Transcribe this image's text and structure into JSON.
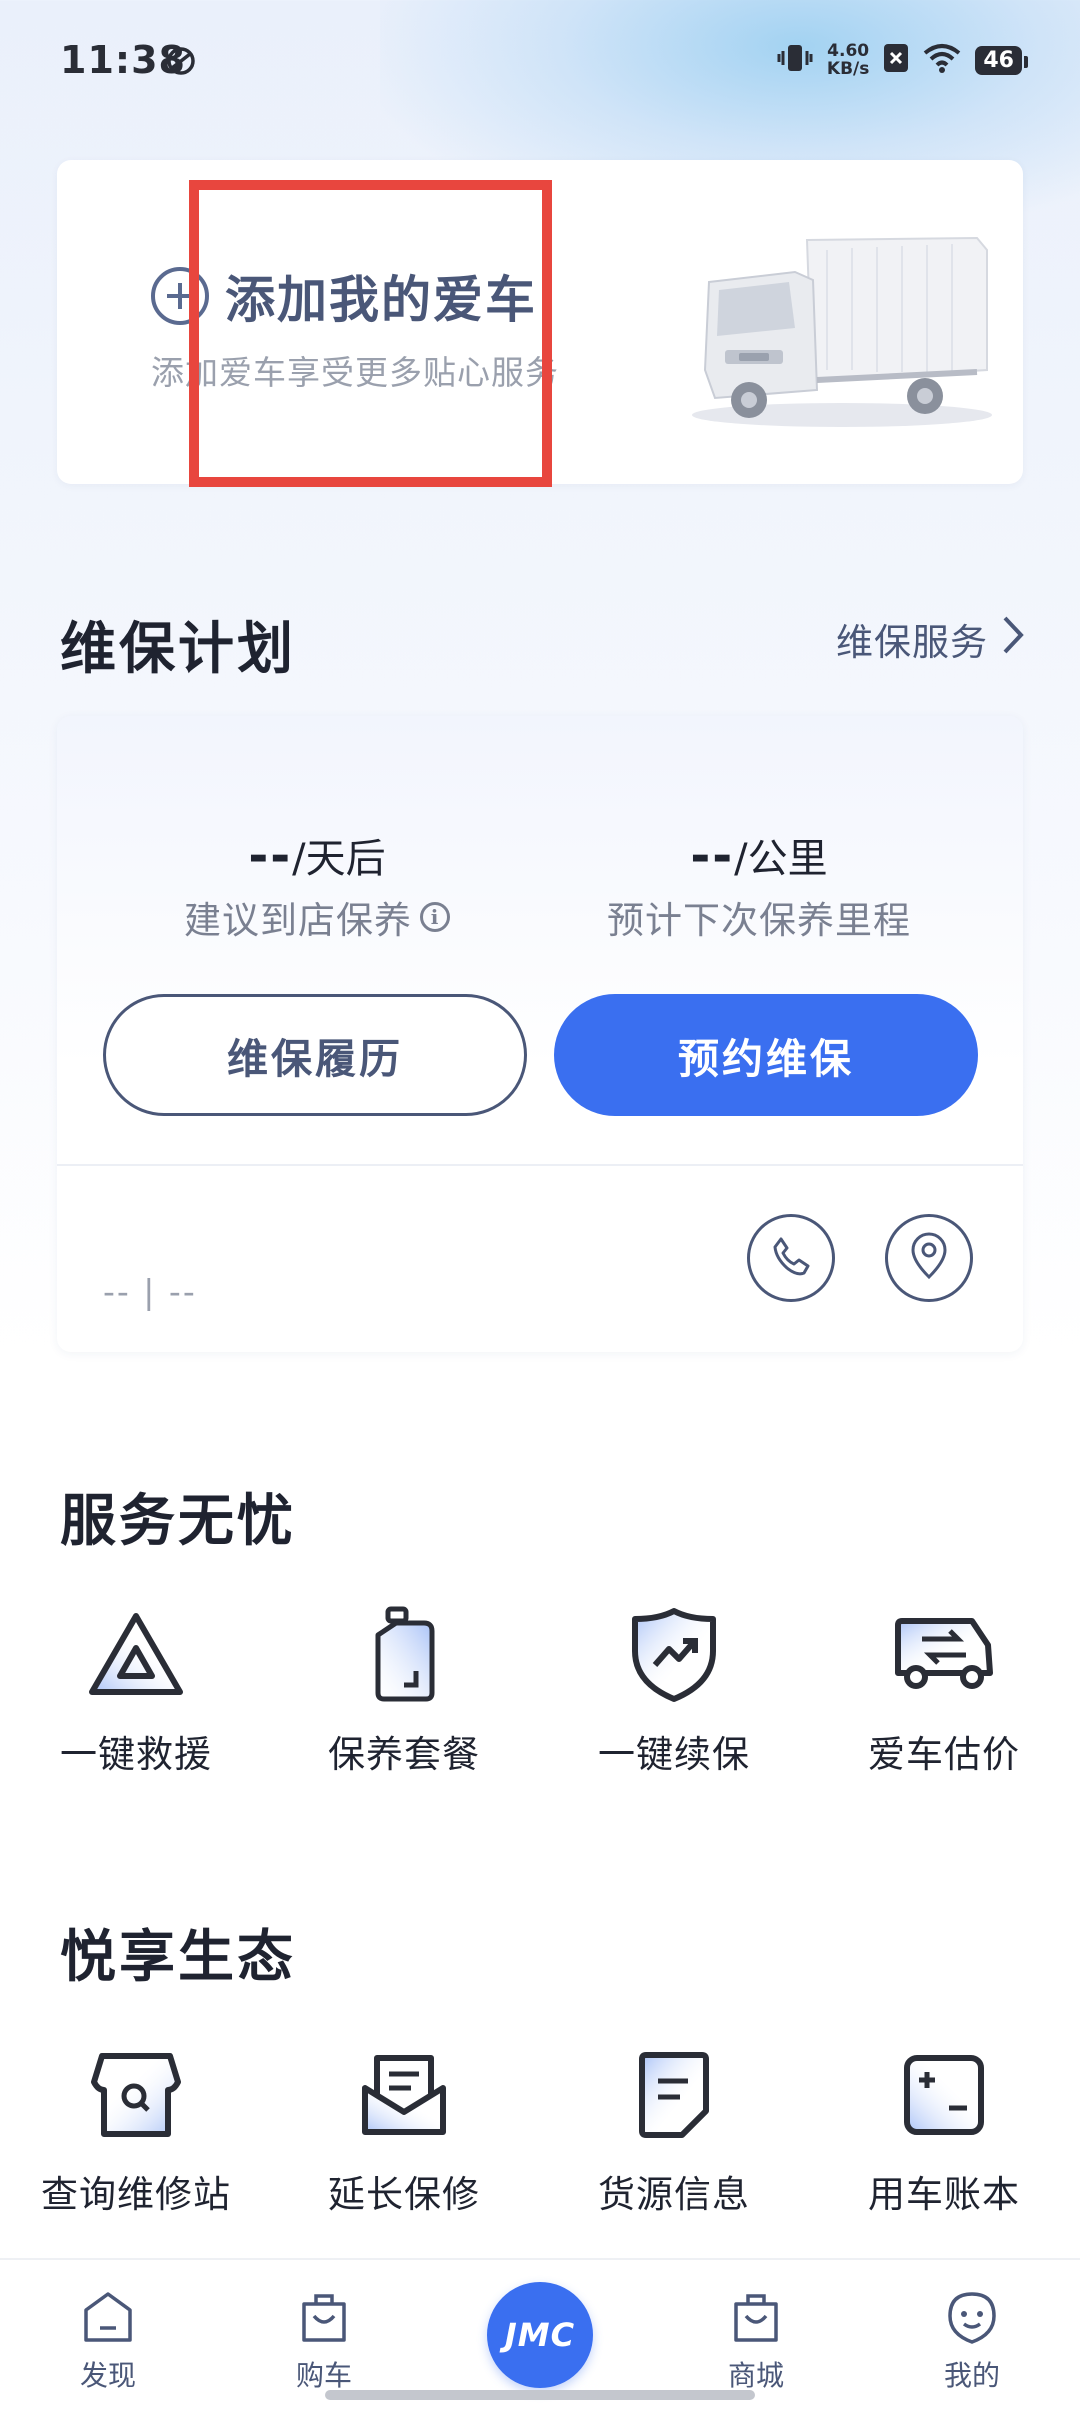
{
  "status_bar": {
    "time": "11:38",
    "net_speed_value": "4.60",
    "net_speed_unit": "KB/s",
    "battery": "46"
  },
  "add_car": {
    "title": "添加我的爱车",
    "subtitle": "添加爱车享受更多贴心服务"
  },
  "maintenance": {
    "section_title": "维保计划",
    "link_label": "维保服务",
    "days_value": "--",
    "days_unit": "/天后",
    "days_label": "建议到店保养",
    "km_value": "--",
    "km_unit": "/公里",
    "km_label": "预计下次保养里程",
    "history_button": "维保履历",
    "book_button": "预约维保",
    "dealer_text": "-- | --"
  },
  "services": {
    "section_title": "服务无忧",
    "items": [
      {
        "label": "一键救援",
        "icon": "warning-triangle-icon"
      },
      {
        "label": "保养套餐",
        "icon": "oil-bottle-icon"
      },
      {
        "label": "一键续保",
        "icon": "shield-trend-icon"
      },
      {
        "label": "爱车估价",
        "icon": "truck-exchange-icon"
      }
    ]
  },
  "ecosystem": {
    "section_title": "悦享生态",
    "items": [
      {
        "label": "查询维修站",
        "icon": "store-search-icon"
      },
      {
        "label": "延长保修",
        "icon": "envelope-doc-icon"
      },
      {
        "label": "货源信息",
        "icon": "document-icon"
      },
      {
        "label": "用车账本",
        "icon": "calculator-icon"
      }
    ]
  },
  "bottom_nav": {
    "items": [
      {
        "label": "发现",
        "icon": "discover-icon"
      },
      {
        "label": "购车",
        "icon": "shopping-bag-icon"
      },
      {
        "label": "商城",
        "icon": "mall-bag-icon"
      },
      {
        "label": "我的",
        "icon": "profile-icon"
      }
    ],
    "center_label": "JMC"
  },
  "colors": {
    "accent": "#3a6ff0",
    "annotation": "#e8463e",
    "text_dark": "#1f2330",
    "text_muted": "#7a8091"
  }
}
